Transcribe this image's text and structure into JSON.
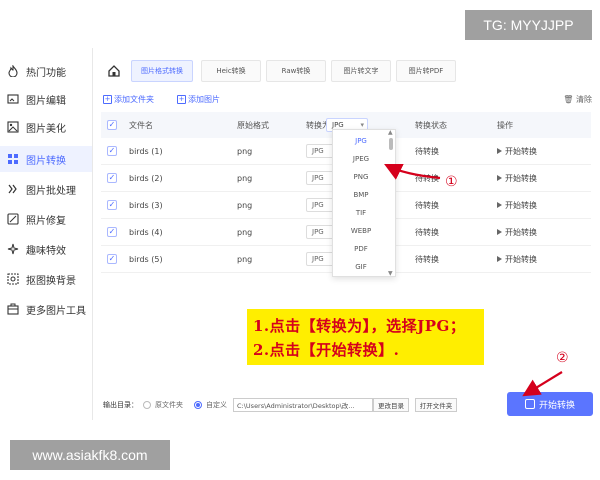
{
  "watermarks": {
    "top": "TG: MYYJJPP",
    "bottom": "www.asiakfk8.com"
  },
  "sidebar": {
    "items": [
      {
        "label": "热门功能",
        "icon": "flame-icon"
      },
      {
        "label": "图片编辑",
        "icon": "image-edit-icon"
      },
      {
        "label": "图片美化",
        "icon": "image-beautify-icon"
      },
      {
        "label": "图片转换",
        "icon": "convert-icon",
        "active": true
      },
      {
        "label": "图片批处理",
        "icon": "batch-icon"
      },
      {
        "label": "照片修复",
        "icon": "repair-icon"
      },
      {
        "label": "趣味特效",
        "icon": "effects-icon"
      },
      {
        "label": "抠图换背景",
        "icon": "cutout-icon"
      },
      {
        "label": "更多图片工具",
        "icon": "toolbox-icon"
      }
    ]
  },
  "tabs": [
    {
      "label": "图片格式转换",
      "active": true
    },
    {
      "label": "Heic转换"
    },
    {
      "label": "Raw转换"
    },
    {
      "label": "图片转文字"
    },
    {
      "label": "图片转PDF"
    }
  ],
  "toolbar": {
    "add_folder": "添加文件夹",
    "add_image": "添加图片",
    "clear": "清除"
  },
  "table": {
    "headers": {
      "filename": "文件名",
      "original_format": "原始格式",
      "convert_to": "转换为",
      "convert_to_value": "JPG",
      "status": "转换状态",
      "action": "操作"
    },
    "rows": [
      {
        "filename": "birds (1)",
        "format": "png",
        "target": "JPG",
        "status": "待转换",
        "action": "开始转换"
      },
      {
        "filename": "birds (2)",
        "format": "png",
        "target": "JPG",
        "status": "待转换",
        "action": "开始转换"
      },
      {
        "filename": "birds (3)",
        "format": "png",
        "target": "JPG",
        "status": "待转换",
        "action": "开始转换"
      },
      {
        "filename": "birds (4)",
        "format": "png",
        "target": "JPG",
        "status": "待转换",
        "action": "开始转换"
      },
      {
        "filename": "birds (5)",
        "format": "png",
        "target": "JPG",
        "status": "待转换",
        "action": "开始转换"
      }
    ]
  },
  "dropdown": {
    "options": [
      "JPG",
      "JPEG",
      "PNG",
      "BMP",
      "TIF",
      "WEBP",
      "PDF",
      "GIF"
    ],
    "selected": "JPG"
  },
  "banner": {
    "line1": "1.点击【转换为】，选择JPG；",
    "line2": "2.点击【开始转换】."
  },
  "annotations": {
    "marker1": "①",
    "marker2": "②",
    "color": "#d5001c"
  },
  "footer": {
    "output_label": "输出目录：",
    "radio_original": "原文件夹",
    "radio_custom": "自定义",
    "path": "C:\\Users\\Administrator\\Desktop\\改...",
    "change_dir": "更改目录",
    "open_folder": "打开文件夹",
    "start": "开始转换"
  },
  "colors": {
    "accent": "#4d6bff",
    "start_button": "#5b75ff",
    "banner_bg": "#ffee00",
    "banner_text": "#d5001c"
  }
}
